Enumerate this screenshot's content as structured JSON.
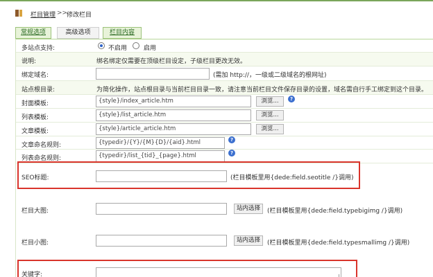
{
  "breadcrumb": {
    "root": "栏目管理",
    "separator": ">>",
    "current": "修改栏目"
  },
  "tabs": [
    {
      "label": "常规选项"
    },
    {
      "label": "高级选项"
    },
    {
      "label": "栏目内容"
    }
  ],
  "form": {
    "multisite": {
      "label": "多站点支持:",
      "options": [
        "不启用",
        "启用"
      ],
      "selected": "不启用"
    },
    "note": {
      "label": "说明:",
      "text": "绑名绑定仅需要在顶级栏目设定，子级栏目更改无效。"
    },
    "domain": {
      "label": "绑定域名:",
      "value": "",
      "hint": "(需加 http://，一级或二级域名的根网址)"
    },
    "rootdir": {
      "label": "站点根目录:",
      "text": "为简化操作，站点根目录与当前栏目目录一致，请注意当前栏目文件保存目录的设置，域名需自行手工绑定到这个目录。"
    },
    "index_tpl": {
      "label": "封面模板:",
      "value": "{style}/index_article.htm",
      "button": "浏览..."
    },
    "list_tpl": {
      "label": "列表模板:",
      "value": "{style}/list_article.htm",
      "button": "浏览..."
    },
    "article_tpl": {
      "label": "文章模板:",
      "value": "{style}/article_article.htm",
      "button": "浏览..."
    },
    "article_rule": {
      "label": "文章命名规则:",
      "value": "{typedir}/{Y}/{M}{D}/{aid}.html"
    },
    "list_rule": {
      "label": "列表命名规则:",
      "value": "{typedir}/list_{tid}_{page}.html"
    },
    "seotitle": {
      "label": "SEO标题:",
      "value": "",
      "hint": "(栏目模板里用{dede:field.seotitle /}调用)"
    },
    "bigpic": {
      "label": "栏目大图:",
      "value": "",
      "button": "站内选择",
      "hint": "(栏目模板里用{dede:field.typebigimg /}调用)"
    },
    "smallpic": {
      "label": "栏目小图:",
      "value": "",
      "button": "站内选择",
      "hint": "(栏目模板里用{dede:field.typesmallimg /}调用)"
    },
    "keywords": {
      "label": "关键字:",
      "value": ""
    }
  },
  "colors": {
    "accent_green": "#7aa65a",
    "highlight_red": "#d9342b",
    "help_blue": "#3b6fcf"
  }
}
